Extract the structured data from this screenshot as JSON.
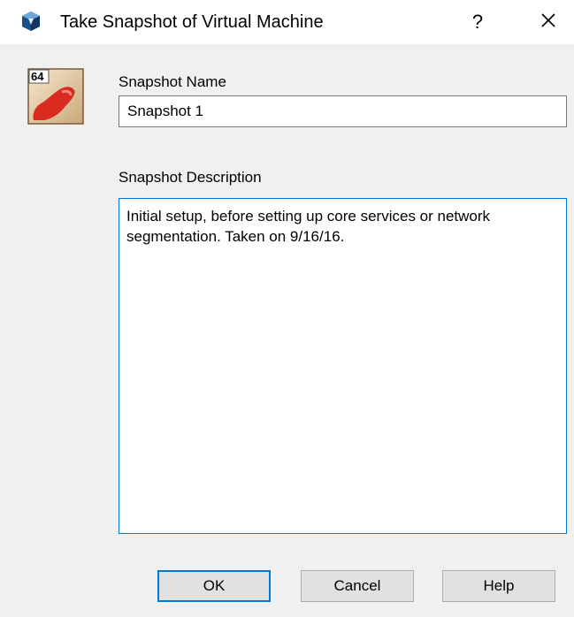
{
  "window": {
    "title": "Take Snapshot of Virtual Machine",
    "help_label": "?",
    "icon": "virtualbox-icon",
    "close_icon": "close-icon"
  },
  "vm": {
    "icon": "vm-os-icon",
    "badge": "64"
  },
  "form": {
    "name_label": "Snapshot Name",
    "name_value": "Snapshot 1",
    "description_label": "Snapshot Description",
    "description_value": "Initial setup, before setting up core services or network segmentation. Taken on 9/16/16."
  },
  "buttons": {
    "ok": "OK",
    "cancel": "Cancel",
    "help": "Help"
  },
  "colors": {
    "focus_accent": "#0078d7",
    "dialog_bg": "#f0f0f0",
    "os_icon_red": "#d92b20"
  }
}
